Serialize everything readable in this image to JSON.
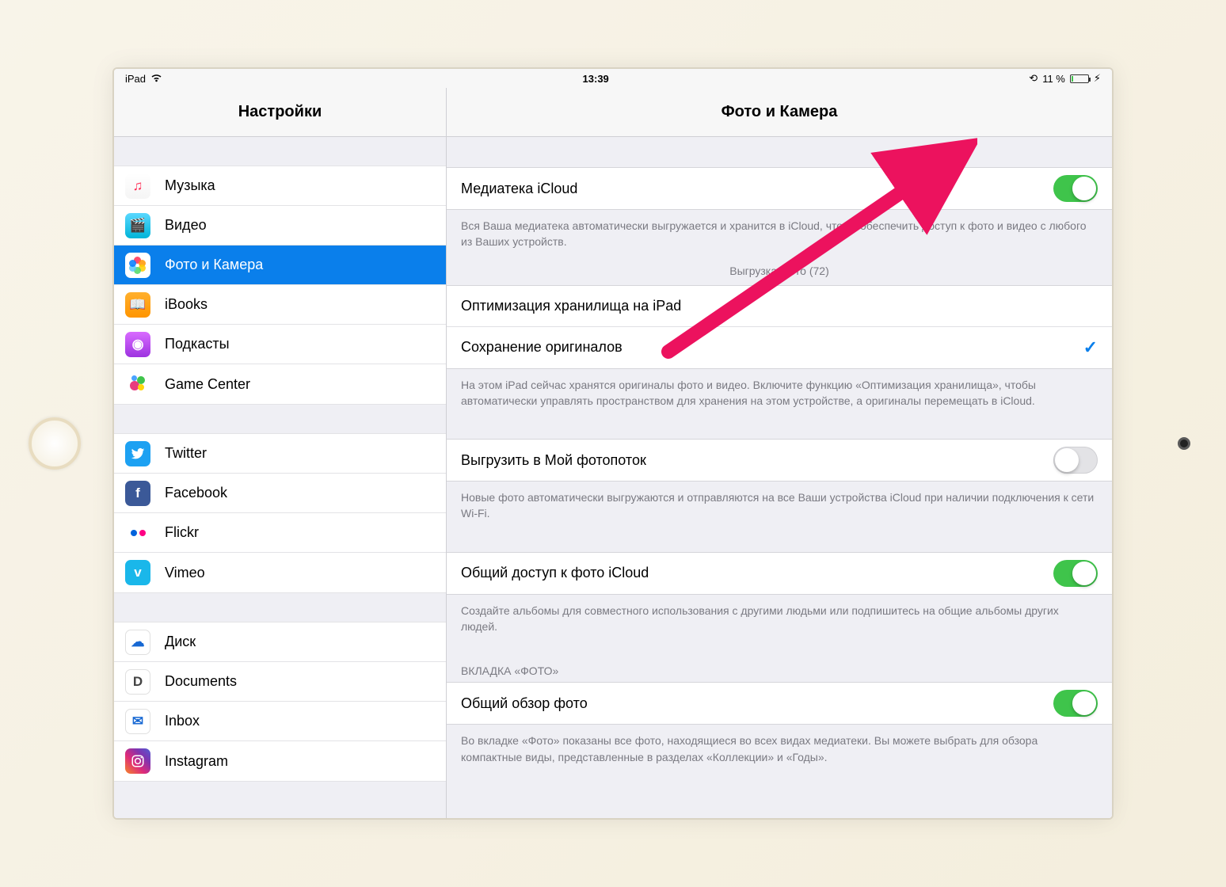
{
  "status": {
    "device": "iPad",
    "time": "13:39",
    "battery_pct": "11 %"
  },
  "sidebar": {
    "title": "Настройки",
    "groups": [
      [
        {
          "id": "music",
          "label": "Музыка"
        },
        {
          "id": "video",
          "label": "Видео"
        },
        {
          "id": "photos",
          "label": "Фото и Камера",
          "active": true
        },
        {
          "id": "ibooks",
          "label": "iBooks"
        },
        {
          "id": "podcasts",
          "label": "Подкасты"
        },
        {
          "id": "gamecenter",
          "label": "Game Center"
        }
      ],
      [
        {
          "id": "twitter",
          "label": "Twitter"
        },
        {
          "id": "facebook",
          "label": "Facebook"
        },
        {
          "id": "flickr",
          "label": "Flickr"
        },
        {
          "id": "vimeo",
          "label": "Vimeo"
        }
      ],
      [
        {
          "id": "disk",
          "label": "Диск"
        },
        {
          "id": "documents",
          "label": "Documents"
        },
        {
          "id": "inbox",
          "label": "Inbox"
        },
        {
          "id": "instagram",
          "label": "Instagram"
        }
      ]
    ]
  },
  "detail": {
    "title": "Фото и Камера",
    "icloud_library": {
      "label": "Медиатека iCloud",
      "on": true,
      "footer": "Вся Ваша медиатека автоматически выгружается и хранится в iCloud, чтобы обеспечить доступ к фото и видео с любого из Ваших устройств.",
      "upload_status": "Выгрузка фото (72)"
    },
    "storage_choice": {
      "optimize": "Оптимизация хранилища на iPad",
      "keep_originals": "Сохранение оригиналов",
      "selected": "keep_originals",
      "footer": "На этом iPad сейчас хранятся оригиналы фото и видео. Включите функцию «Оптимизация хранилища», чтобы автоматически управлять пространством для хранения на этом устройстве, а оригиналы перемещать в iCloud."
    },
    "photo_stream": {
      "label": "Выгрузить в Мой фотопоток",
      "on": false,
      "footer": "Новые фото автоматически выгружаются и отправляются на все Ваши устройства iCloud при наличии подключения к сети Wi-Fi."
    },
    "shared": {
      "label": "Общий доступ к фото iCloud",
      "on": true,
      "footer": "Создайте альбомы для совместного использования с другими людьми или подпишитесь на общие альбомы других людей."
    },
    "photos_tab": {
      "header": "ВКЛАДКА «ФОТО»",
      "summary_label": "Общий обзор фото",
      "summary_on": true,
      "footer": "Во вкладке «Фото» показаны все фото, находящиеся во всех видах медиатеки. Вы можете выбрать для обзора компактные виды, представленные в разделах «Коллекции» и «Годы»."
    }
  }
}
